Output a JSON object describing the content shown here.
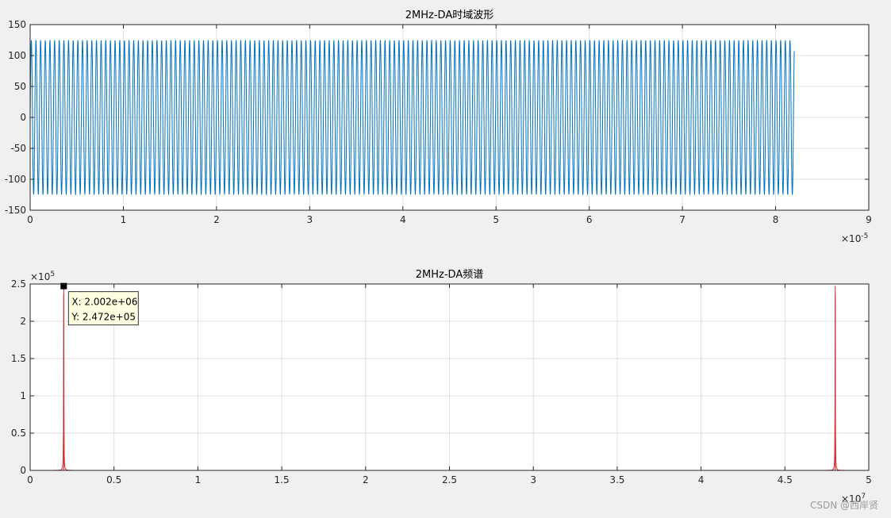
{
  "chart_data": [
    {
      "type": "line",
      "title": "2MHz-DA时域波形",
      "xlabel": "",
      "ylabel": "",
      "xlim": [
        0,
        9e-05
      ],
      "ylim": [
        -150,
        150
      ],
      "x_ticks": [
        0,
        1e-05,
        2e-05,
        3e-05,
        4e-05,
        5e-05,
        6e-05,
        7e-05,
        8e-05,
        9e-05
      ],
      "x_tick_labels": [
        "0",
        "1",
        "2",
        "3",
        "4",
        "5",
        "6",
        "7",
        "8",
        "9"
      ],
      "y_ticks": [
        -150,
        -100,
        -50,
        0,
        50,
        100,
        150
      ],
      "y_tick_labels": [
        "-150",
        "-100",
        "-50",
        "0",
        "50",
        "100",
        "150"
      ],
      "x_exponent": {
        "base": "10",
        "power": "-5"
      },
      "grid": true,
      "series": [
        {
          "color": "#0072bd",
          "signal": {
            "shape": "sine",
            "frequency_hz": 2002000,
            "amplitude": 125,
            "x_start": 0,
            "x_end": 8.2e-05
          }
        }
      ]
    },
    {
      "type": "line",
      "title": "2MHz-DA频谱",
      "xlabel": "",
      "ylabel": "",
      "xlim": [
        0,
        50000000.0
      ],
      "ylim": [
        0,
        250000
      ],
      "x_ticks": [
        0,
        5000000.0,
        10000000.0,
        15000000.0,
        20000000.0,
        25000000.0,
        30000000.0,
        35000000.0,
        40000000.0,
        45000000.0,
        50000000.0
      ],
      "x_tick_labels": [
        "0",
        "0.5",
        "1",
        "1.5",
        "2",
        "2.5",
        "3",
        "3.5",
        "4",
        "4.5",
        "5"
      ],
      "y_ticks": [
        0,
        50000,
        100000,
        150000,
        200000,
        250000
      ],
      "y_tick_labels": [
        "0",
        "0.5",
        "1",
        "1.5",
        "2",
        "2.5"
      ],
      "x_exponent": {
        "base": "10",
        "power": "7"
      },
      "y_exponent": {
        "base": "10",
        "power": "5"
      },
      "grid": true,
      "series": [
        {
          "color": "#d62728",
          "peaks": [
            {
              "x": 2002000,
              "y": 247200
            },
            {
              "x": 47998000,
              "y": 247200
            }
          ],
          "baseline": 0
        }
      ],
      "datatip": {
        "x": 2002000,
        "y": 247200,
        "x_text": "X: 2.002e+06",
        "y_text": "Y: 2.472e+05"
      }
    }
  ],
  "watermark": "CSDN @西岸贤"
}
